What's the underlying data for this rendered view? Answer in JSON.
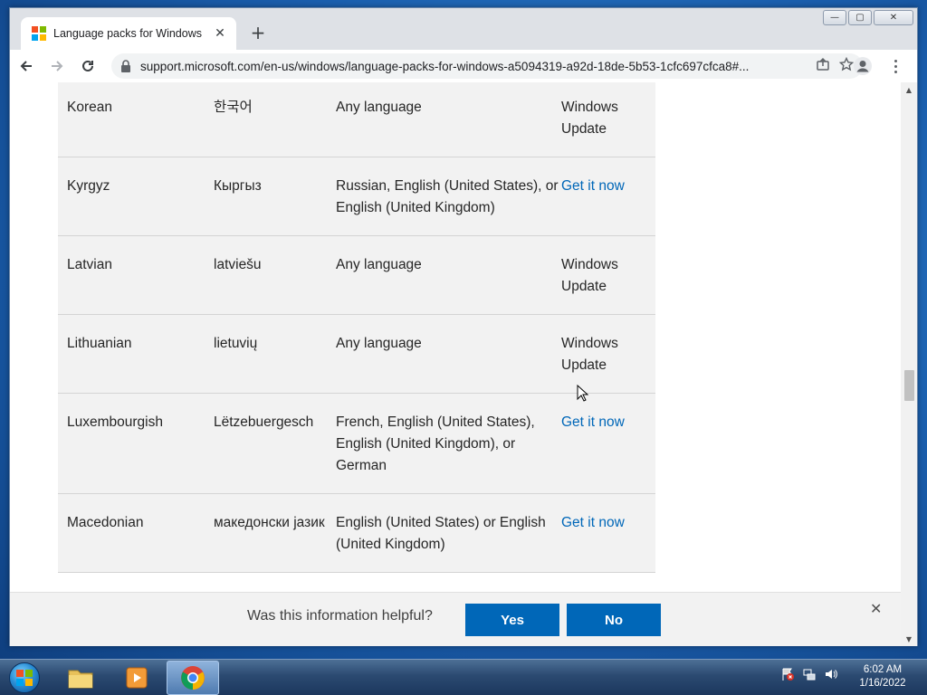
{
  "browser": {
    "tab_title": "Language packs for Windows",
    "url": "support.microsoft.com/en-us/windows/language-packs-for-windows-a5094319-a92d-18de-5b53-1cfc697cfca8#...",
    "window_controls": {
      "minimize": "—",
      "maximize": "▢",
      "close": "✕"
    }
  },
  "table": {
    "rows": [
      {
        "language": "Korean",
        "native": "한국어",
        "base": "Any language",
        "action": "Windows Update",
        "is_link": false
      },
      {
        "language": "Kyrgyz",
        "native": "Кыргыз",
        "base": "Russian, English (United States), or English (United Kingdom)",
        "action": "Get it now",
        "is_link": true
      },
      {
        "language": "Latvian",
        "native": "latviešu",
        "base": "Any language",
        "action": "Windows Update",
        "is_link": false
      },
      {
        "language": "Lithuanian",
        "native": "lietuvių",
        "base": "Any language",
        "action": "Windows Update",
        "is_link": false
      },
      {
        "language": "Luxembourgish",
        "native": "Lëtzebuergesch",
        "base": "French, English (United States), English (United Kingdom), or German",
        "action": "Get it now",
        "is_link": true
      },
      {
        "language": "Macedonian",
        "native": "македонски јазик",
        "base": "English (United States) or English (United Kingdom)",
        "action": "Get it now",
        "is_link": true
      }
    ]
  },
  "feedback": {
    "question": "Was this information helpful?",
    "yes_label": "Yes",
    "no_label": "No"
  },
  "taskbar": {
    "time": "6:02 AM",
    "date": "1/16/2022"
  },
  "colors": {
    "link": "#0067b8",
    "button": "#0067b8"
  }
}
